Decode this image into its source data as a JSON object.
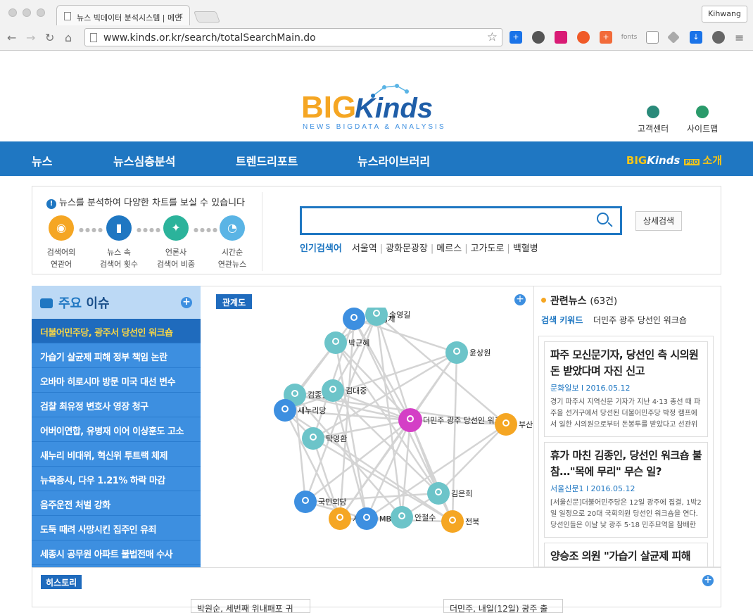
{
  "browser": {
    "tab_title": "뉴스 빅데이터 분석시스템 | 메인",
    "user": "Kihwang",
    "url": "www.kinds.or.kr/search/totalSearchMain.do",
    "fonts_ext": "fonts"
  },
  "logo": {
    "big": "BIG",
    "kinds": "Kinds",
    "tagline": "NEWS BIGDATA & ANALYSIS"
  },
  "toplinks": [
    {
      "label": "고객센터",
      "icon": "customer-icon"
    },
    {
      "label": "사이트맵",
      "icon": "globe-icon"
    }
  ],
  "gnb": {
    "items": [
      "뉴스",
      "뉴스심층분석",
      "트렌드리포트",
      "뉴스라이브러리"
    ],
    "intro_big": "BIG",
    "intro_kinds": "Kinds",
    "intro_pro": "PRO",
    "intro_label": "소개"
  },
  "analysis": {
    "info": "뉴스를 분석하여 다양한 차트를 보실 수 있습니다",
    "tools": [
      {
        "label1": "검색어의",
        "label2": "연관어",
        "color": "#f5a623",
        "icon": "people-icon"
      },
      {
        "label1": "뉴스 속",
        "label2": "검색어 횟수",
        "color": "#1f77c2",
        "icon": "bar-chart-icon"
      },
      {
        "label1": "언론사",
        "label2": "검색어 비중",
        "color": "#2bb39b",
        "icon": "compass-icon"
      },
      {
        "label1": "시간순",
        "label2": "연관뉴스",
        "color": "#5ab4e5",
        "icon": "clock-icon"
      }
    ]
  },
  "search": {
    "placeholder": "",
    "advanced": "상세검색",
    "popular_label": "인기검색어",
    "popular": [
      "서울역",
      "광화문광장",
      "메르스",
      "고가도로",
      "백혈병"
    ]
  },
  "issues": {
    "title_a": "주요",
    "title_b": " 이슈",
    "items": [
      "더불어민주당, 광주서 당선인 워크숍",
      "가습기 살균제 피해 정부 책임 논란",
      "오바마 히로시마 방문 미국 대선 변수",
      "검찰 최유정 변호사 영장 청구",
      "어버이연합, 유병재 이어 이상훈도 고소",
      "새누리 비대위, 혁신위 투트랙 체제",
      "뉴욕증시, 다우 1.21% 하락 마감",
      "음주운전 처벌 강화",
      "도둑 때려 사망시킨 집주인 유죄",
      "세종시 공무원 아파트 불법전매 수사"
    ]
  },
  "graph": {
    "tag": "관계도",
    "center": "더민주 광주 당선인 워크숍",
    "nodes": [
      {
        "id": "hankook",
        "label": "한국경제",
        "type": "org"
      },
      {
        "id": "song",
        "label": "송영길",
        "type": "person"
      },
      {
        "id": "park",
        "label": "박근혜",
        "type": "person"
      },
      {
        "id": "yoon",
        "label": "윤상원",
        "type": "person"
      },
      {
        "id": "kimjong",
        "label": "김종인",
        "type": "person"
      },
      {
        "id": "kimdae",
        "label": "김대중",
        "type": "person"
      },
      {
        "id": "saenuri",
        "label": "새누리당",
        "type": "org"
      },
      {
        "id": "center",
        "label": "더민주 광주 당선인 워크숍",
        "type": "keyword"
      },
      {
        "id": "busan",
        "label": "부산",
        "type": "place"
      },
      {
        "id": "tak",
        "label": "탁영환",
        "type": "person"
      },
      {
        "id": "kimeun",
        "label": "김은희",
        "type": "person"
      },
      {
        "id": "kukmin",
        "label": "국민의당",
        "type": "org"
      },
      {
        "id": "seoul",
        "label": "서울",
        "type": "place"
      },
      {
        "id": "mbn",
        "label": "MBN",
        "type": "org"
      },
      {
        "id": "ahn",
        "label": "안철수",
        "type": "person"
      },
      {
        "id": "jeonbuk",
        "label": "전북",
        "type": "place"
      }
    ],
    "colors": {
      "person": "#6cc4c9",
      "org": "#3d8fe0",
      "place": "#f5a623",
      "keyword": "#d43fc6"
    }
  },
  "news": {
    "title": "관련뉴스",
    "count": "(63건)",
    "kw_label": "검색 키워드",
    "kw_value": "더민주 광주 당선인 워크숍",
    "articles": [
      {
        "title": "파주 모신문기자, 당선인 측 시의원 돈 받았다며 자진 신고",
        "source": "문화일보 l 2016.05.12",
        "summary": "경기 파주시 지역신문 기자가 지난 4·13 총선 때 파주을 선거구에서 당선된 더불어민주당 박정 캠프에서 일한 시의원으로부터 돈봉투를 받았다고 선관위에 신…"
      },
      {
        "title": "휴가 마친 김종인, 당선인 워크숍 불참…\"목에 무리\" 무슨 일?",
        "source": "서울신문1 l 2016.05.12",
        "summary": "[서울신문]더불어민주당은 12일 광주에 집결, 1박2일 일정으로 20대 국회의원 당선인 워크숍을 연다. 당선인들은 이날 낮 광주 5·18 민주묘역을 참배한 뒤 …"
      },
      {
        "title": "양승조 의원 \"가습기 살균제 피해",
        "source": "",
        "summary": ""
      }
    ]
  },
  "history": {
    "tag": "히스토리",
    "cards": [
      "박원순, 세번째 위내패포 귀",
      "더민주, 내일(12일) 광주 출"
    ]
  }
}
